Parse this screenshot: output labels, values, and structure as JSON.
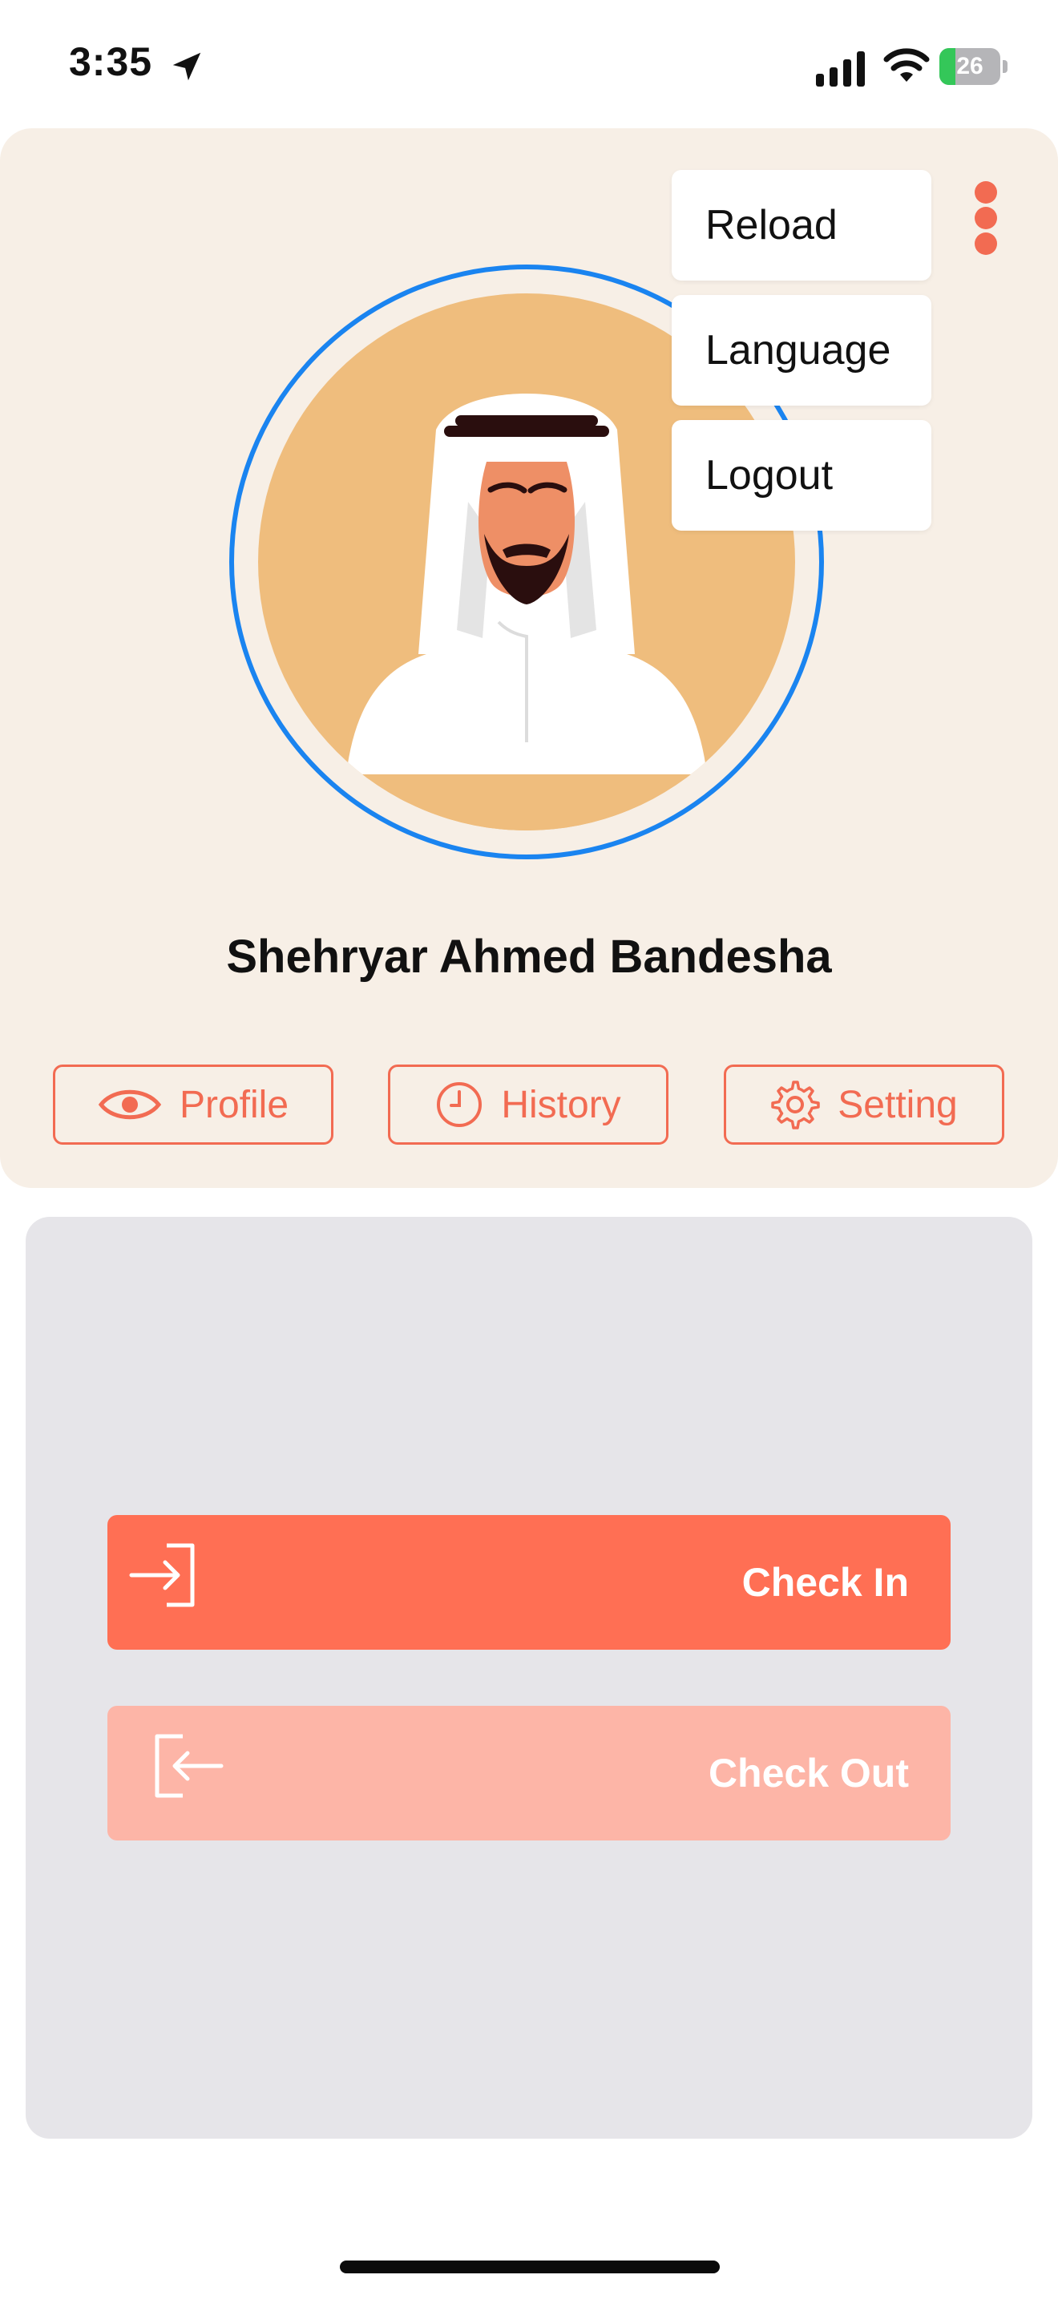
{
  "status_bar": {
    "time": "3:35",
    "battery_level": "26",
    "battery_fraction": 0.26,
    "icons": [
      "location-arrow-icon",
      "cellular-signal-icon",
      "wifi-icon",
      "battery-charging-icon"
    ]
  },
  "profile": {
    "user_name": "Shehryar Ahmed Bandesha",
    "buttons": {
      "profile": "Profile",
      "history": "History",
      "setting": "Setting"
    }
  },
  "menu": {
    "items": [
      "Reload",
      "Language",
      "Logout"
    ]
  },
  "attendance": {
    "check_in": "Check In",
    "check_out": "Check Out"
  },
  "colors": {
    "accent": "#f26b52",
    "check_in_bg": "#ff6f54",
    "check_out_bg": "#fdb5a7",
    "card_bg": "#f7efe6",
    "panel_bg": "#e6e5e9",
    "avatar_ring": "#1a84f0"
  }
}
